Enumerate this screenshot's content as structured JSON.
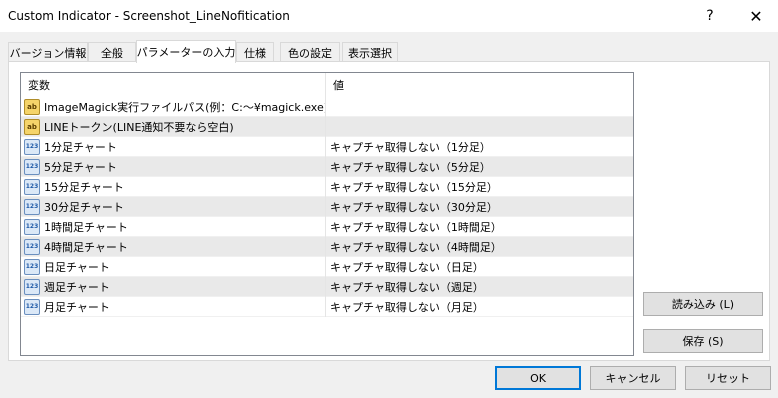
{
  "window": {
    "title": "Custom Indicator - Screenshot_LineNofitication",
    "help_label": "?",
    "close_label": "✕"
  },
  "tabs": [
    {
      "label": "バージョン情報"
    },
    {
      "label": "全般"
    },
    {
      "label": "パラメーターの入力"
    },
    {
      "label": "仕様"
    },
    {
      "label": "色の設定"
    },
    {
      "label": "表示選択"
    }
  ],
  "grid": {
    "headers": {
      "variable": "変数",
      "value": "値"
    },
    "rows": [
      {
        "icon": "string-icon",
        "icon_text": "ab",
        "name": "ImageMagick実行ファイルパス(例：C:～¥magick.exe)",
        "value": ""
      },
      {
        "icon": "string-icon",
        "icon_text": "ab",
        "name": "LINEトークン(LINE通知不要なら空白)",
        "value": ""
      },
      {
        "icon": "number-icon",
        "icon_text": "123",
        "name": "1分足チャート",
        "value": "キャプチャ取得しない（1分足）"
      },
      {
        "icon": "number-icon",
        "icon_text": "123",
        "name": "5分足チャート",
        "value": "キャプチャ取得しない（5分足）"
      },
      {
        "icon": "number-icon",
        "icon_text": "123",
        "name": "15分足チャート",
        "value": "キャプチャ取得しない（15分足）"
      },
      {
        "icon": "number-icon",
        "icon_text": "123",
        "name": "30分足チャート",
        "value": "キャプチャ取得しない（30分足）"
      },
      {
        "icon": "number-icon",
        "icon_text": "123",
        "name": "1時間足チャート",
        "value": "キャプチャ取得しない（1時間足）"
      },
      {
        "icon": "number-icon",
        "icon_text": "123",
        "name": "4時間足チャート",
        "value": "キャプチャ取得しない（4時間足）"
      },
      {
        "icon": "number-icon",
        "icon_text": "123",
        "name": "日足チャート",
        "value": "キャプチャ取得しない（日足）"
      },
      {
        "icon": "number-icon",
        "icon_text": "123",
        "name": "週足チャート",
        "value": "キャプチャ取得しない（週足）"
      },
      {
        "icon": "number-icon",
        "icon_text": "123",
        "name": "月足チャート",
        "value": "キャプチャ取得しない（月足）"
      }
    ]
  },
  "side_buttons": {
    "load_label": "読み込み (L)",
    "save_label": "保存 (S)"
  },
  "footer": {
    "ok_label": "OK",
    "cancel_label": "キャンセル",
    "reset_label": "リセット"
  },
  "colors": {
    "accent": "#0078d7",
    "row_alt": "#e9e9e9"
  }
}
